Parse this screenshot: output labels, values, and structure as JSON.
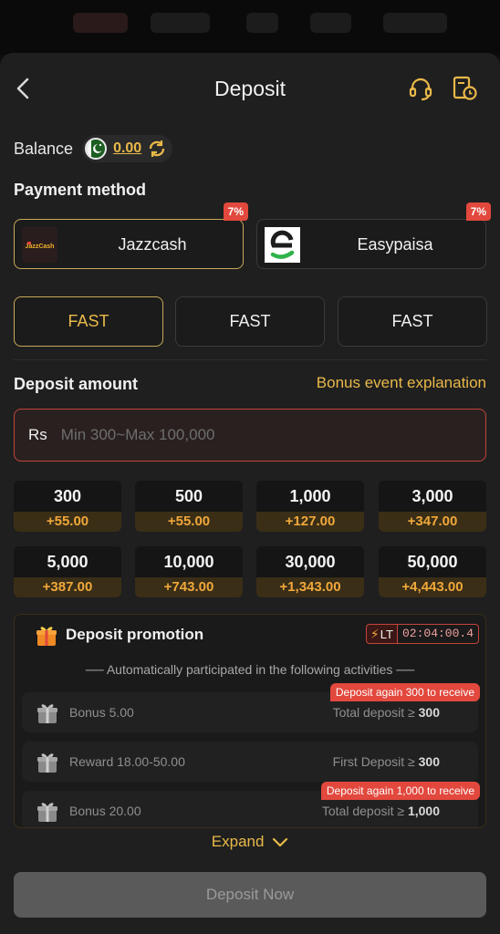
{
  "header": {
    "title": "Deposit"
  },
  "balance": {
    "label": "Balance",
    "value": "0.00"
  },
  "payment": {
    "label": "Payment method",
    "methods": [
      {
        "name": "Jazzcash",
        "rate": "7%",
        "logo_text": "JazzCash",
        "active": true
      },
      {
        "name": "Easypaisa",
        "rate": "7%",
        "active": false
      }
    ],
    "channels": [
      "FAST",
      "FAST",
      "FAST"
    ]
  },
  "amount": {
    "label": "Deposit amount",
    "bonus_link": "Bonus event explanation",
    "currency": "Rs",
    "placeholder": "Min 300~Max 100,000"
  },
  "presets": [
    {
      "amount": "300",
      "bonus": "+55.00"
    },
    {
      "amount": "500",
      "bonus": "+55.00"
    },
    {
      "amount": "1,000",
      "bonus": "+127.00"
    },
    {
      "amount": "3,000",
      "bonus": "+347.00"
    },
    {
      "amount": "5,000",
      "bonus": "+387.00"
    },
    {
      "amount": "10,000",
      "bonus": "+743.00"
    },
    {
      "amount": "30,000",
      "bonus": "+1,343.00"
    },
    {
      "amount": "50,000",
      "bonus": "+4,443.00"
    }
  ],
  "promotion": {
    "title": "Deposit promotion",
    "lt": "LT",
    "timer": "02:04:00.4",
    "subtitle": "── Automatically participated in the following activities ──",
    "activities": [
      {
        "name": "Bonus 5.00",
        "cond_label": "Total deposit ≥",
        "cond_value": "300",
        "badge": "Deposit again 300 to receive"
      },
      {
        "name": "Reward 18.00-50.00",
        "cond_label": "First Deposit ≥",
        "cond_value": "300"
      },
      {
        "name": "Bonus 20.00",
        "cond_label": "Total deposit ≥",
        "cond_value": "1,000",
        "badge": "Deposit again 1,000 to receive"
      }
    ]
  },
  "expand_label": "Expand",
  "deposit_button": "Deposit Now",
  "colors": {
    "accent": "#e9b949",
    "bonus": "#f0a83a",
    "alert": "#e2483d",
    "background": "#1f1f1f"
  }
}
